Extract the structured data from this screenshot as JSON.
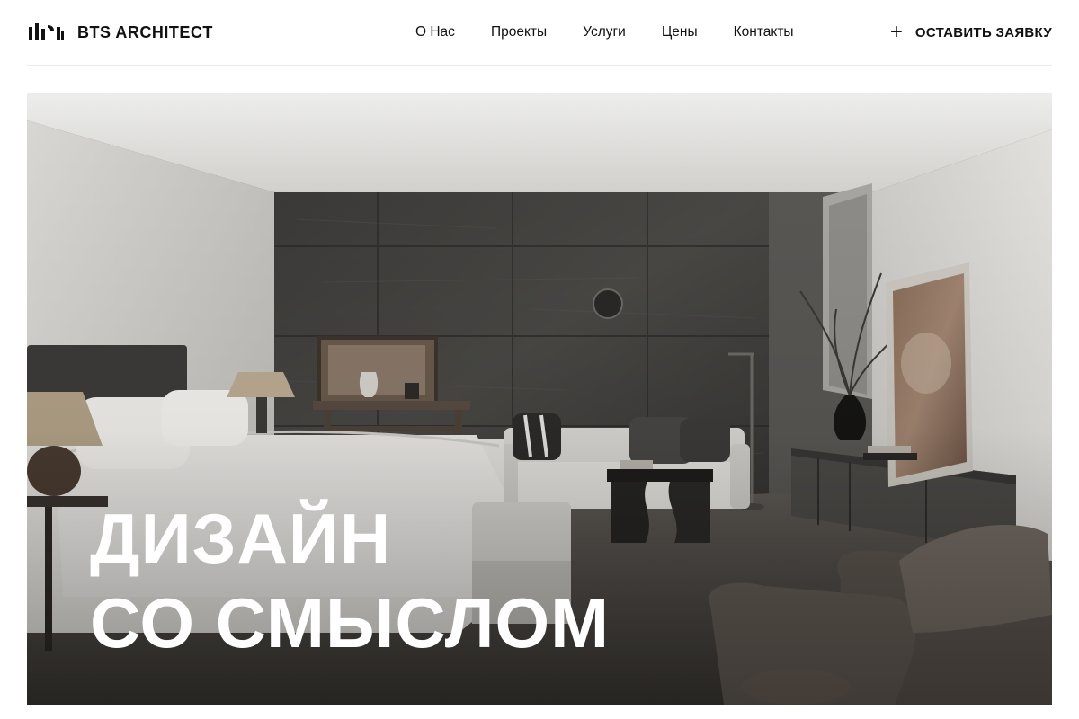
{
  "header": {
    "logo_text": "BTS ARCHITECT",
    "nav": [
      "О Нас",
      "Проекты",
      "Услуги",
      "Цены",
      "Контакты"
    ],
    "cta_icon": "plus-icon",
    "cta_label": "ОСТАВИТЬ ЗАЯВКУ"
  },
  "hero": {
    "title_line1": "ДИЗАЙН",
    "title_line2": "СО СМЫСЛОМ"
  },
  "colors": {
    "text": "#111111",
    "hero_text": "#ffffff",
    "divider": "#ececec"
  }
}
